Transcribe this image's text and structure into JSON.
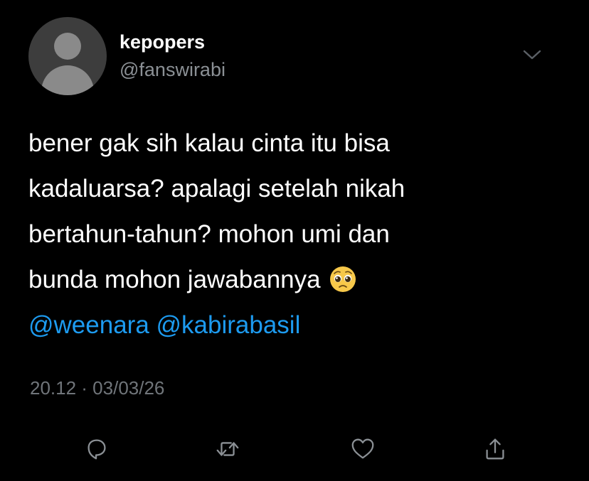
{
  "user": {
    "display_name": "kepopers",
    "handle": "@fanswirabi"
  },
  "tweet": {
    "lines": [
      "bener gak sih kalau cinta itu bisa",
      "kadaluarsa? apalagi setelah nikah",
      "bertahun-tahun? mohon umi dan",
      "bunda mohon jawabannya"
    ],
    "emoji": "pleading-face",
    "mentions": "@weenara @kabirabasil",
    "timestamp": "20.12 · 03/03/26"
  },
  "icons": {
    "menu": "chevron-down-icon",
    "reply": "reply-icon",
    "retweet": "retweet-icon",
    "like": "heart-icon",
    "share": "share-icon"
  },
  "colors": {
    "background": "#000000",
    "text": "#ffffff",
    "secondary_text": "#8b9095",
    "mention": "#1d9bf0",
    "icon": "#8b9095"
  }
}
